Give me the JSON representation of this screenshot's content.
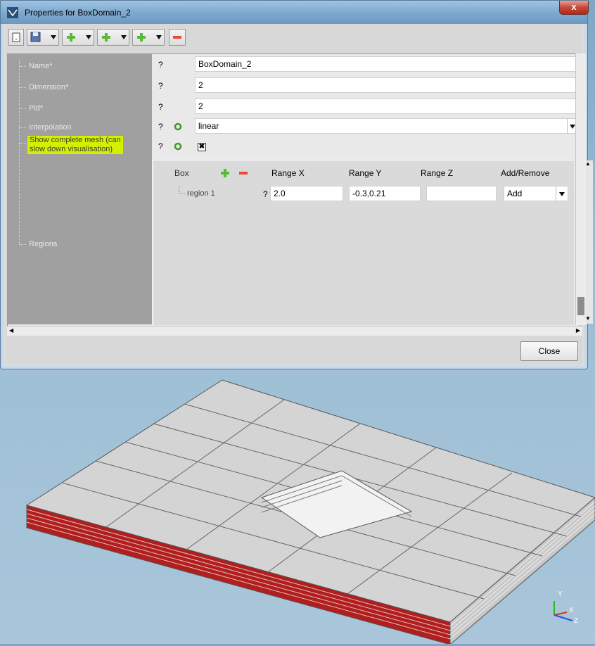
{
  "window": {
    "title": "Properties for BoxDomain_2",
    "close_glyph": "x"
  },
  "toolbar": {
    "icons": [
      "new-icon",
      "save-icon",
      "add-green-icon",
      "add-green-icon",
      "add-green-icon",
      "remove-red-icon"
    ]
  },
  "properties": {
    "name": {
      "label": "Name*",
      "help": "?",
      "value": "BoxDomain_2"
    },
    "dimension": {
      "label": "Dimension*",
      "help": "?",
      "value": "2"
    },
    "pid": {
      "label": "Pid*",
      "help": "?",
      "value": "2"
    },
    "interpolation": {
      "label": "Interpolation",
      "help": "?",
      "value": "linear"
    },
    "show_mesh": {
      "label_line1": "Show complete mesh (can",
      "label_line2": "slow down visualisation)",
      "help": "?",
      "checked_glyph": "✖",
      "checked": true
    },
    "regions": {
      "label": "Regions"
    }
  },
  "regions_table": {
    "headers": {
      "box": "Box",
      "range_x": "Range X",
      "range_y": "Range Y",
      "range_z": "Range Z",
      "add_remove": "Add/Remove"
    },
    "rows": [
      {
        "name": "region 1",
        "help": "?",
        "range_x": "2.0",
        "range_y": "-0.3,0.21",
        "range_z": "",
        "action": "Add"
      }
    ]
  },
  "buttons": {
    "close": "Close"
  },
  "axes": {
    "y": "Y",
    "x": "X",
    "z": "Z"
  },
  "colors": {
    "highlight": "#d4ef00",
    "mesh_face": "#d4d4d4",
    "mesh_side": "#b01e1e",
    "sky_top": "#7fa7c4"
  }
}
